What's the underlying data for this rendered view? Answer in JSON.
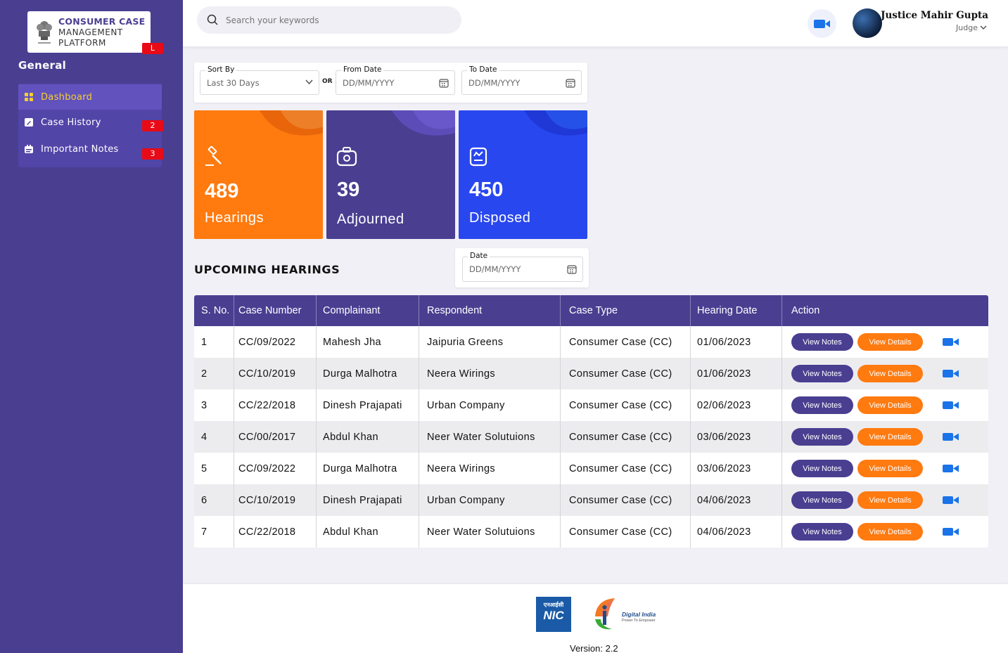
{
  "brand": {
    "line1": "CONSUMER CASE",
    "line2": "MANAGEMENT",
    "line3": "PLATFORM",
    "tag": "L"
  },
  "sidebar": {
    "section_title": "General",
    "items": [
      {
        "label": "Dashboard",
        "icon": "grid-icon",
        "badge": ""
      },
      {
        "label": "Case History",
        "icon": "edit-doc-icon",
        "badge": "2"
      },
      {
        "label": "Important Notes",
        "icon": "notes-icon",
        "badge": "3"
      }
    ]
  },
  "header": {
    "search_placeholder": "Search your keywords",
    "user_name": "Justice Mahir Gupta",
    "user_role": "Judge"
  },
  "filters": {
    "sort_label": "Sort By",
    "sort_value": "Last 30 Days",
    "or_label": "OR",
    "from_label": "From Date",
    "from_placeholder": "DD/MM/YYYY",
    "to_label": "To Date",
    "to_placeholder": "DD/MM/YYYY"
  },
  "stats": [
    {
      "value": "489",
      "label": "Hearings",
      "color": "#ff7a0f"
    },
    {
      "value": "39",
      "label": "Adjourned",
      "color": "#4a3e91"
    },
    {
      "value": "450",
      "label": "Disposed",
      "color": "#2947ef"
    }
  ],
  "upcoming": {
    "title": "UPCOMING HEARINGS",
    "date_label": "Date",
    "date_placeholder": "DD/MM/YYYY"
  },
  "table": {
    "headers": [
      "S. No.",
      "Case Number",
      "Complainant",
      "Respondent",
      "Case Type",
      "Hearing Date",
      "Action"
    ],
    "rows": [
      [
        "1",
        "CC/09/2022",
        "Mahesh Jha",
        "Jaipuria Greens",
        "Consumer Case (CC)",
        "01/06/2023"
      ],
      [
        "2",
        "CC/10/2019",
        "Durga Malhotra",
        "Neera Wirings",
        "Consumer Case (CC)",
        "01/06/2023"
      ],
      [
        "3",
        "CC/22/2018",
        "Dinesh Prajapati",
        "Urban Company",
        "Consumer Case (CC)",
        "02/06/2023"
      ],
      [
        "4",
        "CC/00/2017",
        "Abdul Khan",
        "Neer Water Solutuions",
        "Consumer Case (CC)",
        "03/06/2023"
      ],
      [
        "5",
        "CC/09/2022",
        "Durga Malhotra",
        "Neera Wirings",
        "Consumer Case (CC)",
        "03/06/2023"
      ],
      [
        "6",
        "CC/10/2019",
        "Dinesh Prajapati",
        "Urban Company",
        "Consumer Case (CC)",
        "04/06/2023"
      ],
      [
        "7",
        "CC/22/2018",
        "Abdul Khan",
        "Neer Water Solutuions",
        "Consumer Case (CC)",
        "04/06/2023"
      ]
    ],
    "view_notes_label": "View Notes",
    "view_details_label": "View Details"
  },
  "footer": {
    "nic_hindi": "एनआईसी",
    "nic": "NIC",
    "digital_india": "Digital India",
    "digital_india_tag": "Power To Empower",
    "version": "Version: 2.2"
  },
  "colors": {
    "primary": "#4a3e91",
    "accent_orange": "#ff7a0f",
    "accent_blue": "#2947ef",
    "active_menu_text": "#f5cf2d",
    "badge_red": "#e80b17"
  }
}
